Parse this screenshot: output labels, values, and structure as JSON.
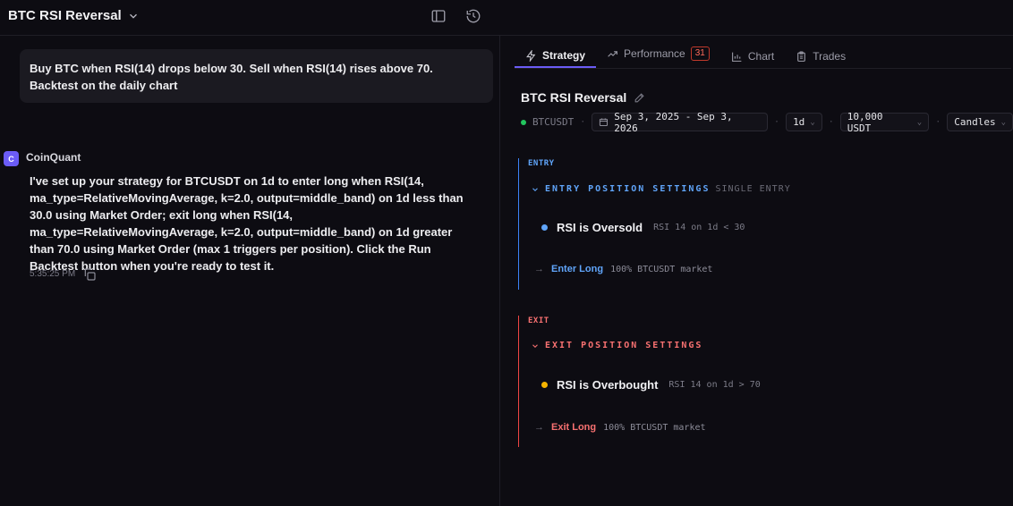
{
  "header": {
    "title": "BTC RSI Reversal"
  },
  "chat": {
    "user_message": "Buy BTC when RSI(14) drops below 30. Sell when RSI(14) rises above 70. Backtest on the daily chart",
    "bot_avatar_letter": "C",
    "bot_name": "CoinQuant",
    "bot_message": "I've set up your strategy for BTCUSDT on 1d to enter long when RSI(14, ma_type=RelativeMovingAverage, k=2.0, output=middle_band) on 1d less than 30.0 using Market Order; exit long when RSI(14, ma_type=RelativeMovingAverage, k=2.0, output=middle_band) on 1d greater than 70.0 using Market Order (max 1 triggers per position). Click the Run Backtest button when you're ready to test it.",
    "timestamp": "5:35:25 PM"
  },
  "tabs": [
    {
      "label": "Strategy",
      "icon": "bolt-icon",
      "active": true
    },
    {
      "label": "Performance",
      "icon": "trend-icon",
      "badge": "31"
    },
    {
      "label": "Chart",
      "icon": "chart-icon"
    },
    {
      "label": "Trades",
      "icon": "clipboard-icon"
    }
  ],
  "strategy": {
    "title": "BTC RSI Reversal",
    "symbol": "BTCUSDT",
    "date_range": "Sep 3, 2025 - Sep 3, 2026",
    "timeframe": "1d",
    "capital": "10,000 USDT",
    "chart_type": "Candles",
    "status_color": "#22c55e"
  },
  "entry": {
    "label": "ENTRY",
    "heading": "ENTRY POSITION SETTINGS",
    "sub": "SINGLE ENTRY",
    "condition_name": "RSI is Oversold",
    "condition_expr": "RSI 14 on 1d < 30",
    "condition_color": "#60a5fa",
    "action_name": "Enter Long",
    "action_desc": "100% BTCUSDT market"
  },
  "exit": {
    "label": "EXIT",
    "heading": "EXIT POSITION SETTINGS",
    "condition_name": "RSI is Overbought",
    "condition_expr": "RSI 14 on 1d > 70",
    "condition_color": "#f5b400",
    "action_name": "Exit Long",
    "action_desc": "100% BTCUSDT market"
  }
}
